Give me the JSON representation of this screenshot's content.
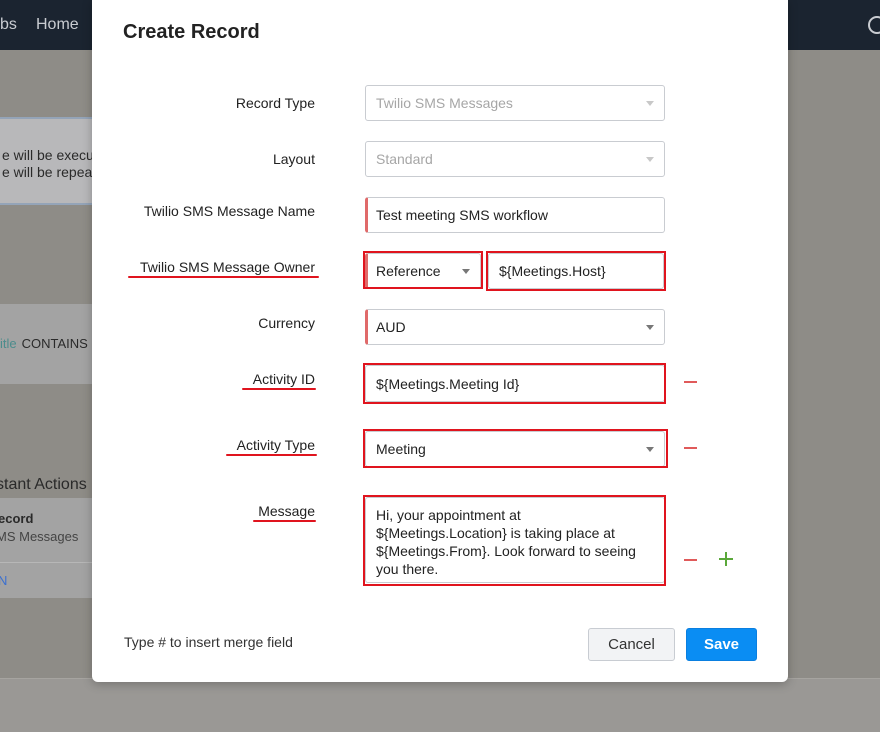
{
  "background": {
    "nav_tabs": "bs",
    "nav_home": "Home",
    "info_line1": "e will be execu",
    "info_line2": "e will be repea",
    "condition_field": "itle",
    "condition_operator": "CONTAINS",
    "instant_actions_title": "stant Actions",
    "instant_item_title": "ecord",
    "instant_item_sub": "MS Messages",
    "instant_item_link": "N"
  },
  "modal": {
    "title": "Create Record",
    "fields": {
      "record_type": {
        "label": "Record Type",
        "value": "Twilio SMS Messages"
      },
      "layout": {
        "label": "Layout",
        "value": "Standard"
      },
      "name": {
        "label": "Twilio SMS Message Name",
        "value": "Test meeting SMS workflow"
      },
      "owner": {
        "label": "Twilio SMS Message Owner",
        "type_value": "Reference",
        "value": "${Meetings.Host}"
      },
      "currency": {
        "label": "Currency",
        "value": "AUD"
      },
      "activity_id": {
        "label": "Activity ID",
        "value": "${Meetings.Meeting Id}"
      },
      "activity_type": {
        "label": "Activity Type",
        "value": "Meeting"
      },
      "message": {
        "label": "Message",
        "value": "Hi, your appointment at\n${Meetings.Location} is taking place at\n${Meetings.From}. Look forward to seeing\nyou there."
      }
    },
    "hint": "Type # to insert merge field",
    "cancel_label": "Cancel",
    "save_label": "Save"
  },
  "colors": {
    "highlight": "#e0141e",
    "save_button": "#0a8df3",
    "remove_icon": "#e05a5a",
    "add_icon": "#5aa83a"
  }
}
